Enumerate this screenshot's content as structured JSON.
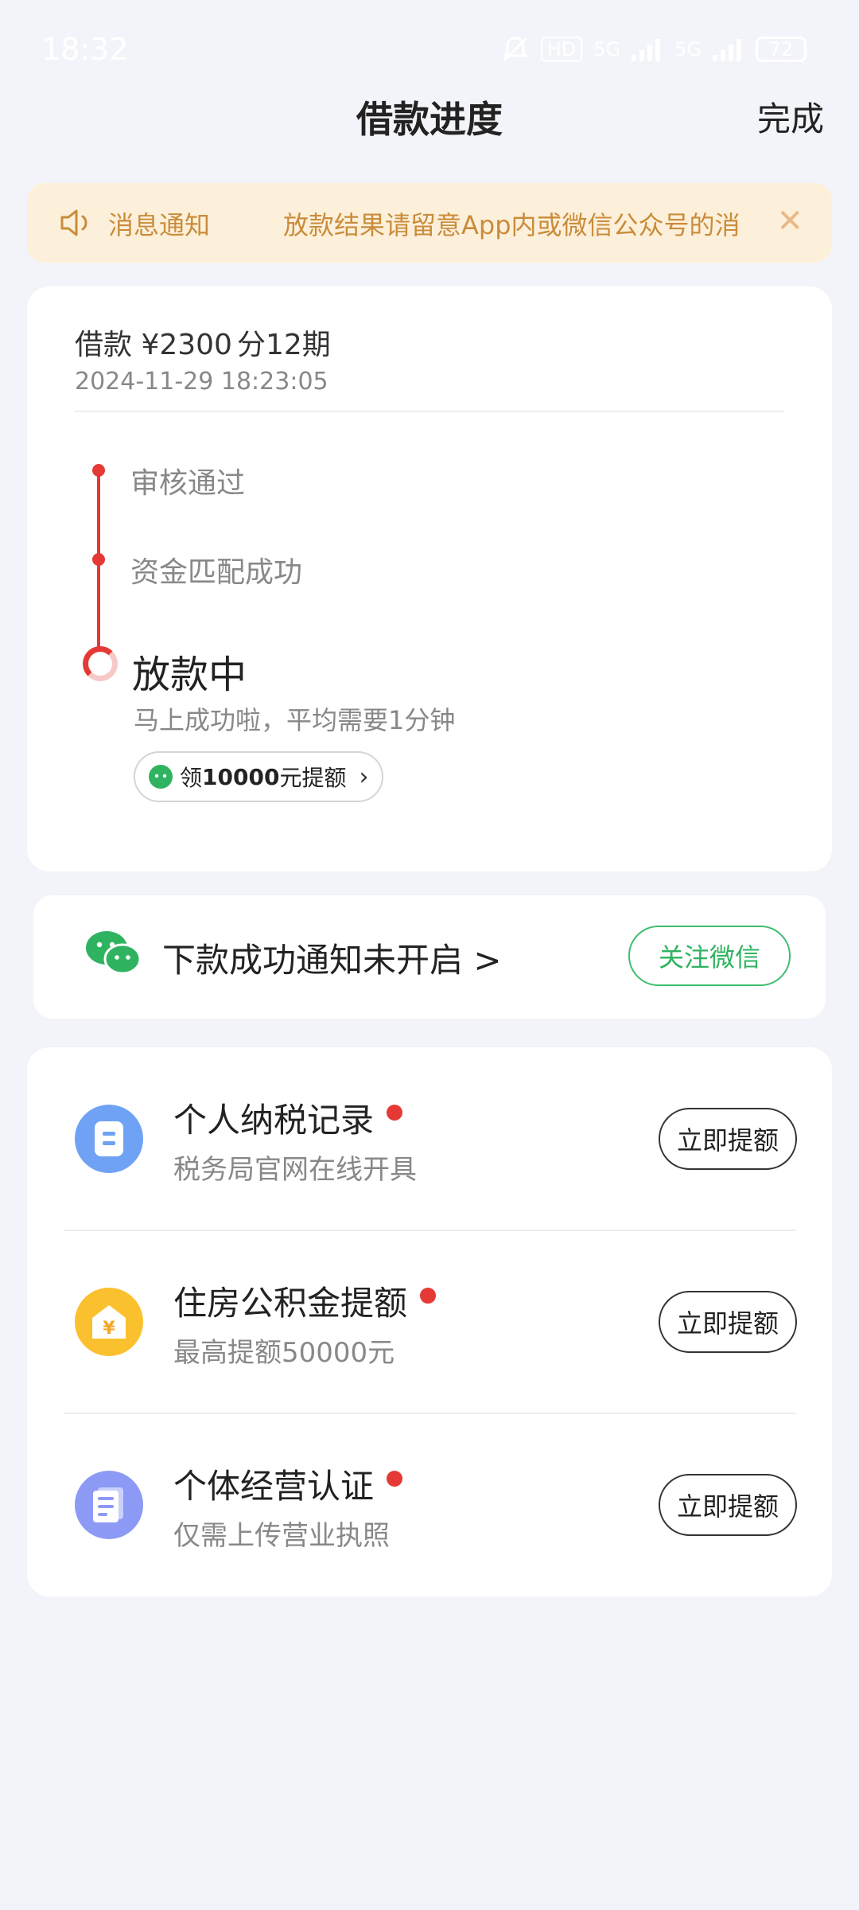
{
  "status_bar": {
    "time": "18:32",
    "hd": "HD",
    "net1": "5G",
    "net2": "5G",
    "battery": "72"
  },
  "header": {
    "title": "借款进度",
    "done_label": "完成"
  },
  "notice": {
    "title": "消息通知",
    "text": "放款结果请留意App内或微信公众号的消",
    "close": "✕"
  },
  "loan": {
    "amount": "借款 ¥2300",
    "period": "分12期",
    "time": "2024-11-29 18:23:05",
    "steps": [
      {
        "label": "审核通过"
      },
      {
        "label": "资金匹配成功"
      }
    ],
    "current": {
      "title": "放款中",
      "subtitle": "马上成功啦，平均需要1分钟",
      "pill_prefix": "领",
      "pill_amount": "10000",
      "pill_suffix": "元提额",
      "pill_chevron": "›"
    }
  },
  "wechat": {
    "text": "下款成功通知未开启 >",
    "follow_label": "关注微信"
  },
  "quota_items": [
    {
      "title": "个人纳税记录",
      "subtitle": "税务局官网在线开具",
      "button": "立即提额",
      "icon": "tax-document-icon",
      "color": "#6fa2f5"
    },
    {
      "title": "住房公积金提额",
      "subtitle": "最高提额50000元",
      "button": "立即提额",
      "icon": "house-yen-icon",
      "color": "#fbc02d",
      "glyph": "¥"
    },
    {
      "title": "个体经营认证",
      "subtitle": "仅需上传营业执照",
      "button": "立即提额",
      "icon": "business-license-icon",
      "color": "#8c9af5"
    }
  ]
}
